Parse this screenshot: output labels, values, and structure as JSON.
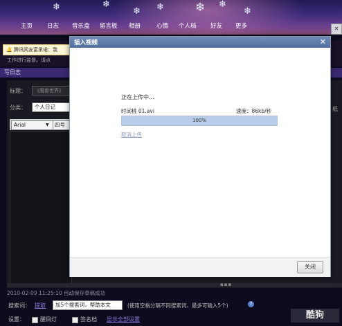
{
  "nav": {
    "items": [
      "主页",
      "日志",
      "音乐盒",
      "留言板",
      "相册",
      "心情",
      "个人档",
      "好友",
      "更多"
    ]
  },
  "notice": {
    "line1": "腾讯网友富承诺：我",
    "line2": "工作进行监督。请点"
  },
  "section": {
    "title": "写日志"
  },
  "form": {
    "title_label": "标题：",
    "title_placeholder": "《魔兽世界》",
    "category_label": "分类：",
    "category_value": "个人日记"
  },
  "toolbar": {
    "font": "Arial",
    "size": "四号"
  },
  "right_cut": {
    "label": "纸"
  },
  "dialog": {
    "title": "插入视频",
    "uploading": "正在上传中...",
    "filename": "时间桃 01.avi",
    "speed": "速度：86kb/秒",
    "progress_text": "100%",
    "progress": 1.0,
    "cancel_link": "取消上传",
    "close_button": "关闭"
  },
  "status": {
    "saved": "2010-02-09 11:25:10 自动保存草稿成功"
  },
  "search": {
    "label": "搜索词：",
    "hint_link": "提取",
    "placeholder": "加5个搜索词，帮助本文",
    "note": "(使用空格分隔不同搜索词，最多可输入5个)"
  },
  "settings": {
    "label": "设置：",
    "opt1": "醒目灯",
    "opt2": "签名档",
    "more_link": "显示全部设置"
  },
  "watermark": "酷狗"
}
